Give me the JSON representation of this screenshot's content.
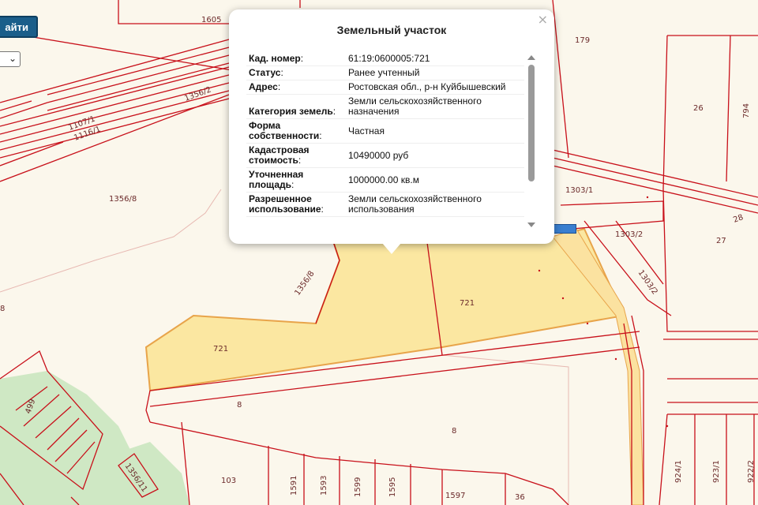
{
  "toolbar": {
    "find_label": "айти",
    "select_value": ""
  },
  "popup": {
    "title": "Земельный участок",
    "close_glyph": "×",
    "rows": [
      {
        "key": "Кад. номер",
        "value": "61:19:0600005:721"
      },
      {
        "key": "Статус",
        "value": "Ранее учтенный"
      },
      {
        "key": "Адрес",
        "value": "Ростовская обл., р-н Куйбышевский"
      },
      {
        "key": "Категория земель",
        "key_lines": [
          "Категория",
          "земель"
        ],
        "value": "Земли сельскохозяйственного назначения"
      },
      {
        "key": "Форма собственности",
        "key_lines": [
          "Форма",
          "собственности"
        ],
        "value": "Частная"
      },
      {
        "key": "Кадастровая стоимость",
        "key_lines": [
          "Кадастровая",
          "стоимость"
        ],
        "value": "10490000 руб"
      },
      {
        "key": "Уточненная площадь",
        "key_lines": [
          "Уточненная",
          "площадь"
        ],
        "value": "1000000.00 кв.м"
      },
      {
        "key": "Разрешенное использование",
        "key_lines": [
          "Разрешенное",
          "использование"
        ],
        "value": "Земли сельскохозяйственного использования"
      }
    ]
  },
  "map": {
    "colors": {
      "boundary": "#c8101a",
      "selected_fill": "#fbe7a1",
      "selected_stroke": "#e8a44a",
      "green": "#cfe8c4",
      "background": "#fbf7ec"
    },
    "labels": {
      "p1605": "1605",
      "p179": "179",
      "p26": "26",
      "p794": "794",
      "p1107": "1107/1",
      "p1116": "1116/1",
      "p1356_2": "1356/2",
      "p1356_8a": "1356/8",
      "p1356_8b": "1356/8",
      "p8left": "8",
      "p1303_1": "1303/1",
      "p1303_2a": "1303/2",
      "p1303_2b": "1303/2",
      "p28": "28",
      "p27": "27",
      "p721a": "721",
      "p721b": "721",
      "p8a": "8",
      "p8b": "8",
      "p499": "499",
      "p1356_11": "1356/11",
      "p103": "103",
      "p1591": "1591",
      "p1593": "1593",
      "p1599": "1599",
      "p1595": "1595",
      "p1597": "1597",
      "p36": "36",
      "p924": "924/1",
      "p923": "923/1",
      "p922": "922/2"
    }
  }
}
